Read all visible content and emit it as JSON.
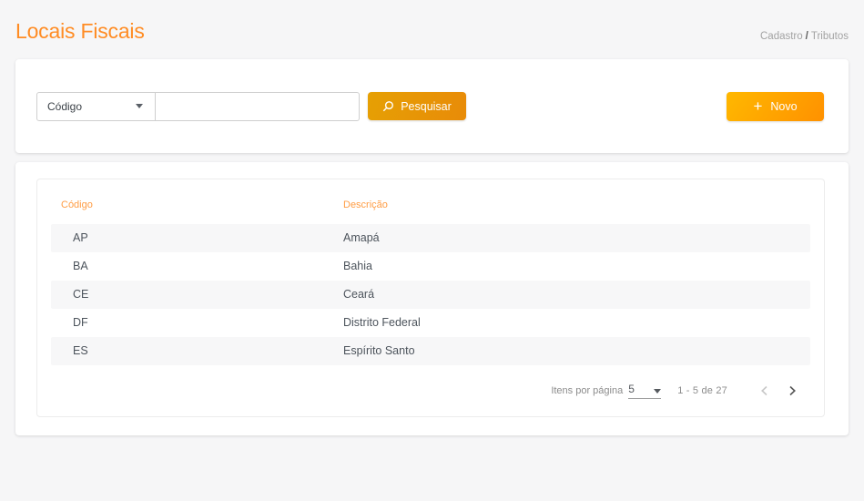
{
  "page": {
    "title": "Locais Fiscais"
  },
  "breadcrumb": {
    "parent": "Cadastro",
    "separator": "/",
    "current": "Tributos"
  },
  "search": {
    "field_selected": "Código",
    "input_value": "",
    "button_label": "Pesquisar",
    "search_icon": "magnifier",
    "chevron_icon": "chevron-down"
  },
  "actions": {
    "new_label": "Novo",
    "plus_icon": "+"
  },
  "table": {
    "columns": [
      "Código",
      "Descrição"
    ],
    "rows": [
      {
        "codigo": "AP",
        "descricao": "Amapá"
      },
      {
        "codigo": "BA",
        "descricao": "Bahia"
      },
      {
        "codigo": "CE",
        "descricao": "Ceará"
      },
      {
        "codigo": "DF",
        "descricao": "Distrito Federal"
      },
      {
        "codigo": "ES",
        "descricao": "Espírito Santo"
      }
    ]
  },
  "pagination": {
    "items_per_page_label": "Itens por página",
    "page_size": "5",
    "range_label": "1 - 5 de 27",
    "prev_icon": "chevron-left",
    "next_icon": "chevron-right",
    "prev_enabled": false,
    "next_enabled": true
  },
  "colors": {
    "accent_title": "#ff8c24",
    "table_header_text": "#ff9d45",
    "search_button_gradient": [
      "#e6a004",
      "#e88b08"
    ],
    "new_button_gradient": [
      "#ffb800",
      "#ff9100"
    ],
    "row_stripe": "#f7f7f8",
    "page_background": "#f6f6f7"
  }
}
